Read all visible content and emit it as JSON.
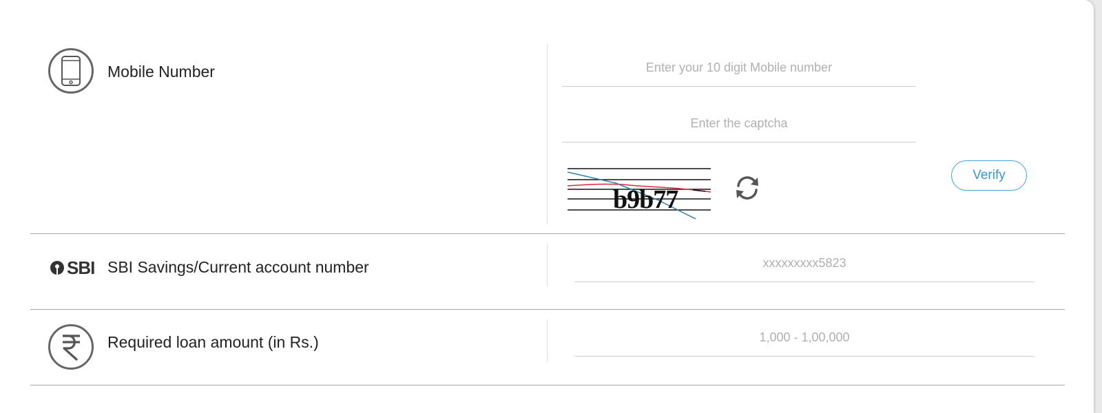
{
  "mobile": {
    "label": "Mobile Number",
    "mobile_placeholder": "Enter your 10 digit Mobile number",
    "captcha_placeholder": "Enter the captcha",
    "captcha_text": "b9b77",
    "verify_label": "Verify"
  },
  "account": {
    "logo_text": "SBI",
    "label": "SBI Savings/Current account number",
    "placeholder": "xxxxxxxxx5823"
  },
  "loan": {
    "label": "Required loan amount (in Rs.)",
    "placeholder": "1,000 - 1,00,000"
  },
  "icons": {
    "mobile": "mobile-phone-icon",
    "refresh": "refresh-icon",
    "sbi": "sbi-logo-icon",
    "rupee": "rupee-icon"
  },
  "colors": {
    "accent": "#3fa2d8",
    "icon_gray": "#666666",
    "divider": "#a9a9a9"
  }
}
